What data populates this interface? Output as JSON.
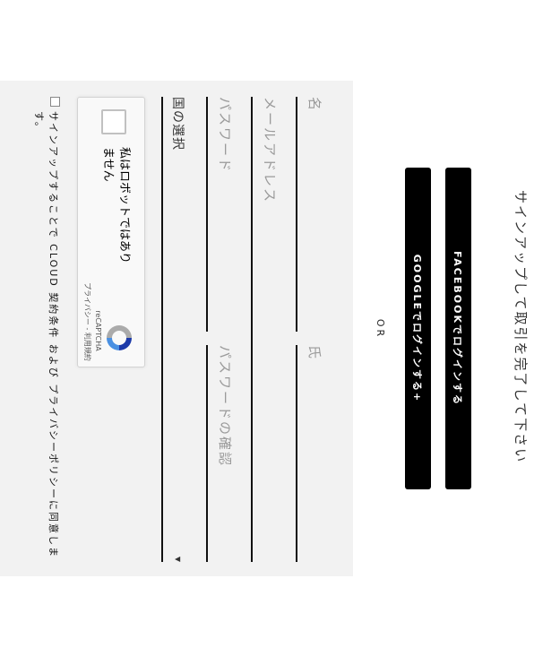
{
  "header": {
    "title": "サインアップして取引を完了して下さい"
  },
  "social": {
    "facebook_label": "FACEBOOKでログインする",
    "google_label": "GOOGLEでログインする+"
  },
  "divider": {
    "or_label": "OR"
  },
  "form": {
    "first_name": {
      "placeholder": "名",
      "value": ""
    },
    "last_name": {
      "placeholder": "氏",
      "value": ""
    },
    "email": {
      "placeholder": "メールアドレス",
      "value": ""
    },
    "password": {
      "placeholder": "パスワード",
      "value": ""
    },
    "password_confirm": {
      "placeholder": "パスワードの確認",
      "value": ""
    },
    "country": {
      "selected": "国の選択"
    }
  },
  "recaptcha": {
    "label": "私はロボットではありません",
    "brand": "reCAPTCHA",
    "links": "プライバシー - 利用規約"
  },
  "terms": {
    "text": "サインアップすることで CLOUD 契約条件 および プライバシーポリシーに同意します。"
  }
}
